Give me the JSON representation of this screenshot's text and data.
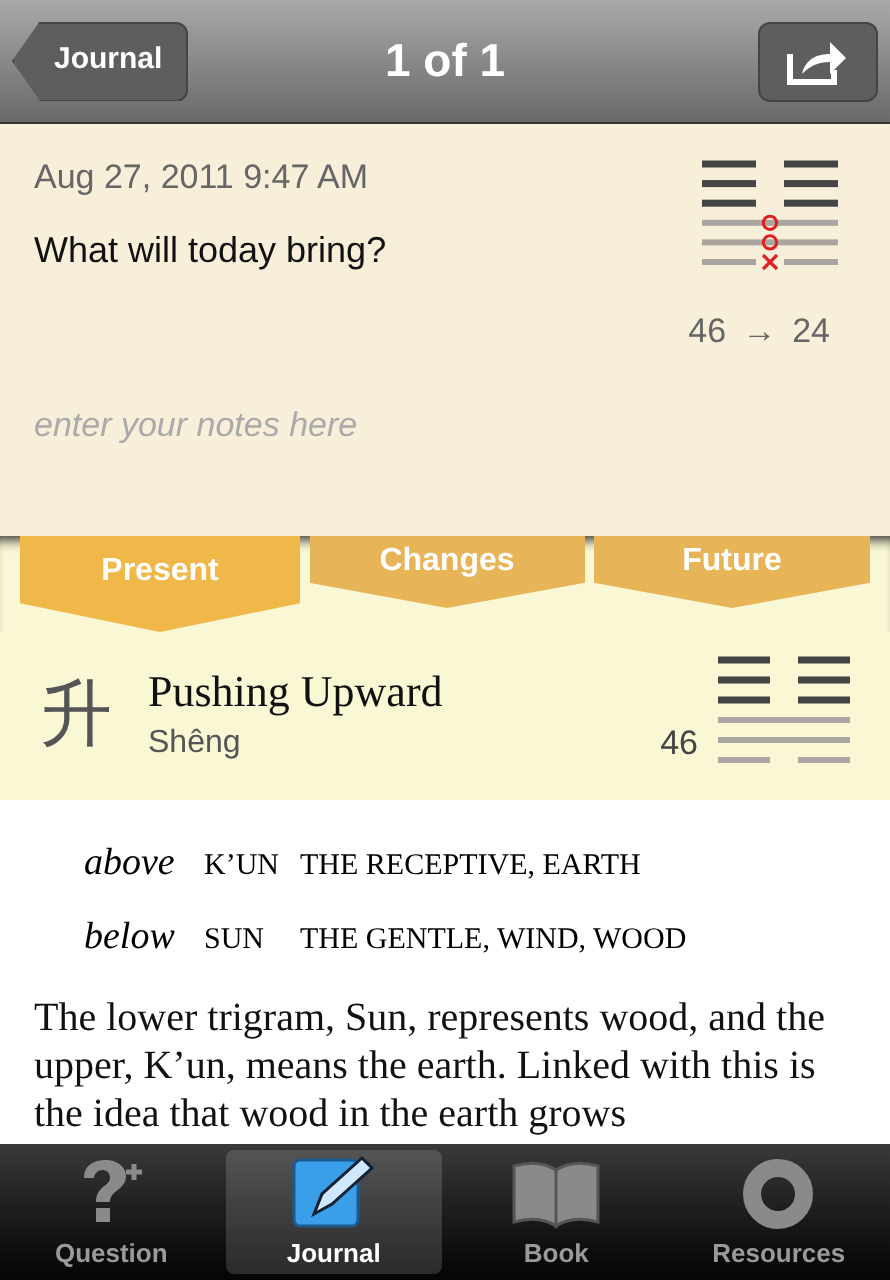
{
  "nav": {
    "back": "Journal",
    "title": "1 of 1"
  },
  "entry": {
    "date": "Aug 27, 2011 9:47 AM",
    "question": "What will today bring?",
    "notes_placeholder": "enter your notes here",
    "from": "46",
    "arrow": "→",
    "to": "24",
    "lines": [
      {
        "kind": "yin",
        "dim": false,
        "moving": false
      },
      {
        "kind": "yin",
        "dim": false,
        "moving": false
      },
      {
        "kind": "yin",
        "dim": false,
        "moving": false
      },
      {
        "kind": "yang",
        "dim": true,
        "moving": true
      },
      {
        "kind": "yang",
        "dim": true,
        "moving": true
      },
      {
        "kind": "yin",
        "dim": true,
        "moving": true
      }
    ]
  },
  "tabs": [
    {
      "label": "Present",
      "selected": true
    },
    {
      "label": "Changes",
      "selected": false
    },
    {
      "label": "Future",
      "selected": false
    }
  ],
  "hexagram": {
    "character": "升",
    "name": "Pushing Upward",
    "romanization": "Shêng",
    "number": "46",
    "lines": [
      {
        "kind": "yin",
        "dim": false
      },
      {
        "kind": "yin",
        "dim": false
      },
      {
        "kind": "yin",
        "dim": false
      },
      {
        "kind": "yang",
        "dim": true
      },
      {
        "kind": "yang",
        "dim": true
      },
      {
        "kind": "yin",
        "dim": true
      }
    ]
  },
  "trigrams": [
    {
      "position": "above",
      "name": "K’UN",
      "meaning": "THE RECEPTIVE, EARTH"
    },
    {
      "position": "below",
      "name": "SUN",
      "meaning": "THE GENTLE, WIND, WOOD"
    }
  ],
  "body": "The lower trigram, Sun, represents wood, and the upper, K’un, means the earth. Linked with this is the idea that wood in the earth grows",
  "tab_bar": [
    {
      "label": "Question",
      "selected": false
    },
    {
      "label": "Journal",
      "selected": true
    },
    {
      "label": "Book",
      "selected": false
    },
    {
      "label": "Resources",
      "selected": false
    }
  ]
}
